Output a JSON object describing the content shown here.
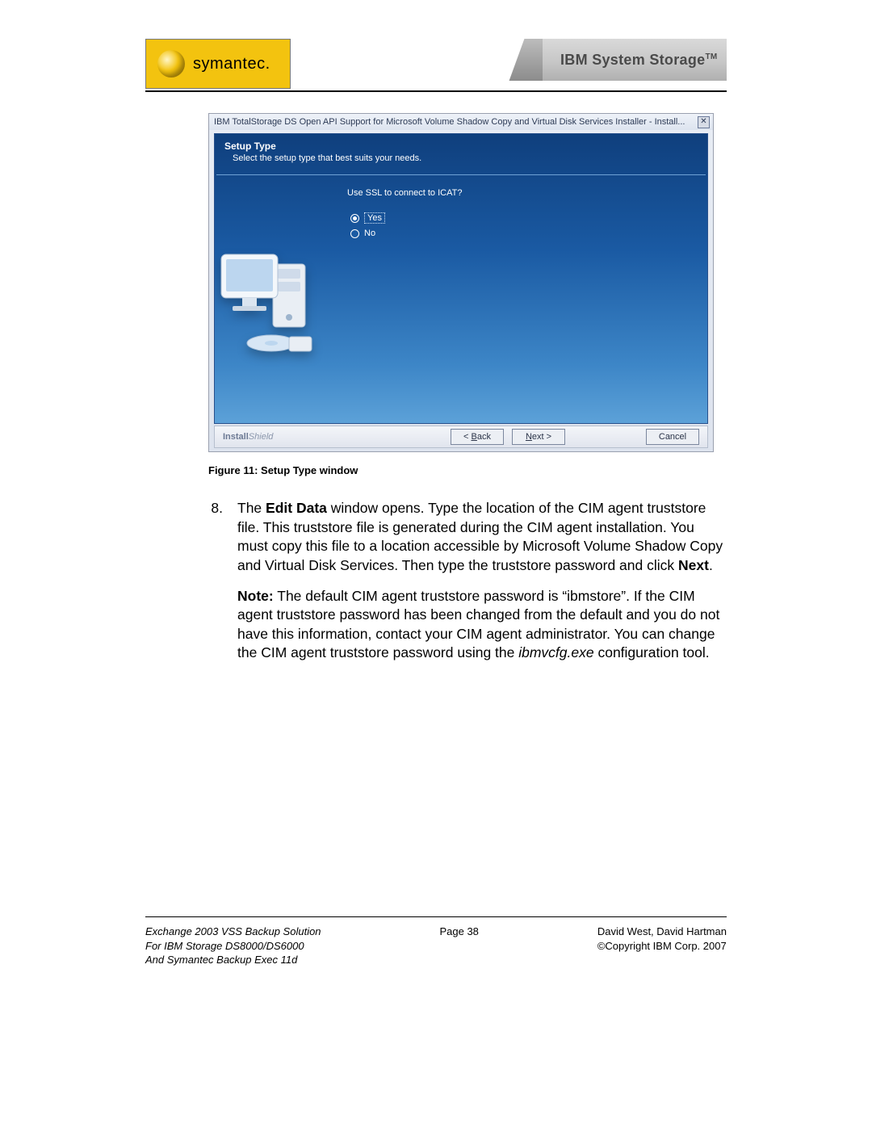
{
  "header": {
    "symantec_word": "symantec.",
    "ibm_text": "IBM System Storage",
    "ibm_tm": "TM"
  },
  "dialog": {
    "title": "IBM TotalStorage DS Open API Support for Microsoft Volume Shadow Copy and Virtual Disk Services Installer - Install...",
    "heading": "Setup Type",
    "subheading": "Select the setup type that best suits your needs.",
    "prompt": "Use SSL to connect to ICAT?",
    "radio_yes": "Yes",
    "radio_no": "No",
    "brand_a": "Install",
    "brand_b": "Shield",
    "btn_back": "< Back",
    "btn_next": "Next >",
    "btn_cancel": "Cancel"
  },
  "caption": "Figure 11: Setup Type window",
  "step": {
    "num": "8.",
    "t1": "The ",
    "b1": "Edit Data",
    "t2": " window opens. Type the location of the CIM agent truststore file. This truststore file is generated during the CIM agent installation. You must copy this file to a location accessible by Microsoft Volume Shadow Copy and Virtual Disk Services. Then type the truststore password and click ",
    "b2": "Next",
    "t3": "."
  },
  "note": {
    "b": "Note:",
    "t1": " The default CIM agent truststore password is “ibmstore”. If the CIM agent truststore password has been changed from the default and you do not have this information, contact your CIM agent administrator. You can change the CIM agent truststore password using the ",
    "i": "ibmvcfg.exe",
    "t2": " configuration tool."
  },
  "footer": {
    "l1": "Exchange 2003 VSS Backup Solution",
    "l2": "For IBM Storage DS8000/DS6000",
    "l3": "And Symantec Backup Exec 11d",
    "page": "Page 38",
    "r1": "David West, David Hartman",
    "r2": "©Copyright IBM Corp. 2007"
  }
}
